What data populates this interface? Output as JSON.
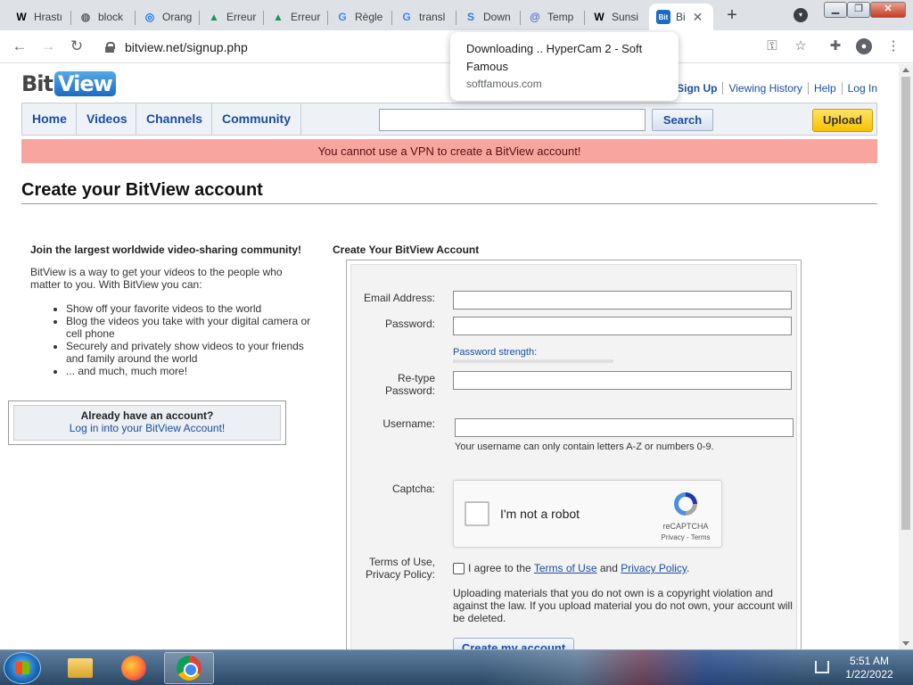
{
  "browser": {
    "tabs": [
      {
        "icon": "W",
        "label": "Hrastı"
      },
      {
        "icon": "◍",
        "label": "block"
      },
      {
        "icon": "◎",
        "label": "Orang"
      },
      {
        "icon": "▲",
        "label": "Erreur"
      },
      {
        "icon": "▲",
        "label": "Erreur"
      },
      {
        "icon": "G",
        "label": "Règle"
      },
      {
        "icon": "G",
        "label": "transl"
      },
      {
        "icon": "S",
        "label": "Down"
      },
      {
        "icon": "@",
        "label": "Temp"
      },
      {
        "icon": "W",
        "label": "Sunsi"
      },
      {
        "icon": "Bit",
        "label": "Bi"
      }
    ],
    "new_tab": "+",
    "url": "bitview.net/signup.php"
  },
  "download_popup": {
    "title": "Downloading .. HyperCam 2 - Soft Famous",
    "domain": "softfamous.com"
  },
  "site": {
    "logo_bit": "Bit",
    "logo_view": "View",
    "top_links": [
      "Sign Up",
      "Viewing History",
      "Help",
      "Log In"
    ],
    "nav": [
      "Home",
      "Videos",
      "Channels",
      "Community"
    ],
    "search_button": "Search",
    "search_value": "",
    "upload_button": "Upload",
    "vpn_banner": "You cannot use a VPN to create a BitView account!",
    "page_title": "Create your BitView account"
  },
  "intro": {
    "heading": "Join the largest worldwide video-sharing community!",
    "text": "BitView is a way to get your videos to the people who matter to you. With BitView you can:",
    "benefits": [
      "Show off your favorite videos to the world",
      "Blog the videos you take with your digital camera or cell phone",
      "Securely and privately show videos to your friends and family around the world",
      "... and much, much more!"
    ],
    "login_question": "Already have an account?",
    "login_link": "Log in into your BitView Account!"
  },
  "form": {
    "heading": "Create Your BitView Account",
    "email_label": "Email Address:",
    "password_label": "Password:",
    "password_strength": "Password strength:",
    "retype_label": "Re-type Password:",
    "username_label": "Username:",
    "username_hint": "Your username can only contain letters A-Z or numbers 0-9.",
    "captcha_label": "Captcha:",
    "recaptcha_text": "I'm not a robot",
    "recaptcha_brand": "reCAPTCHA",
    "recaptcha_terms": "Privacy - Terms",
    "terms_label_1": "Terms of Use,",
    "terms_label_2": "Privacy Policy:",
    "agree_prefix": "I agree to the",
    "terms_link": "Terms of Use",
    "agree_and": "and",
    "privacy_link": "Privacy Policy",
    "agree_suffix": ".",
    "copyright_notice": "Uploading materials that you do not own is a copyright violation and against the law. If you upload material you do not own, your account will be deleted.",
    "submit": "Create my account"
  },
  "taskbar": {
    "time": "5:51 AM",
    "date": "1/22/2022"
  },
  "colors": {
    "link_blue": "#1a4fa0",
    "vpn_banner_bg": "#f8a5a0",
    "upload_yellow": "#f5c200"
  }
}
